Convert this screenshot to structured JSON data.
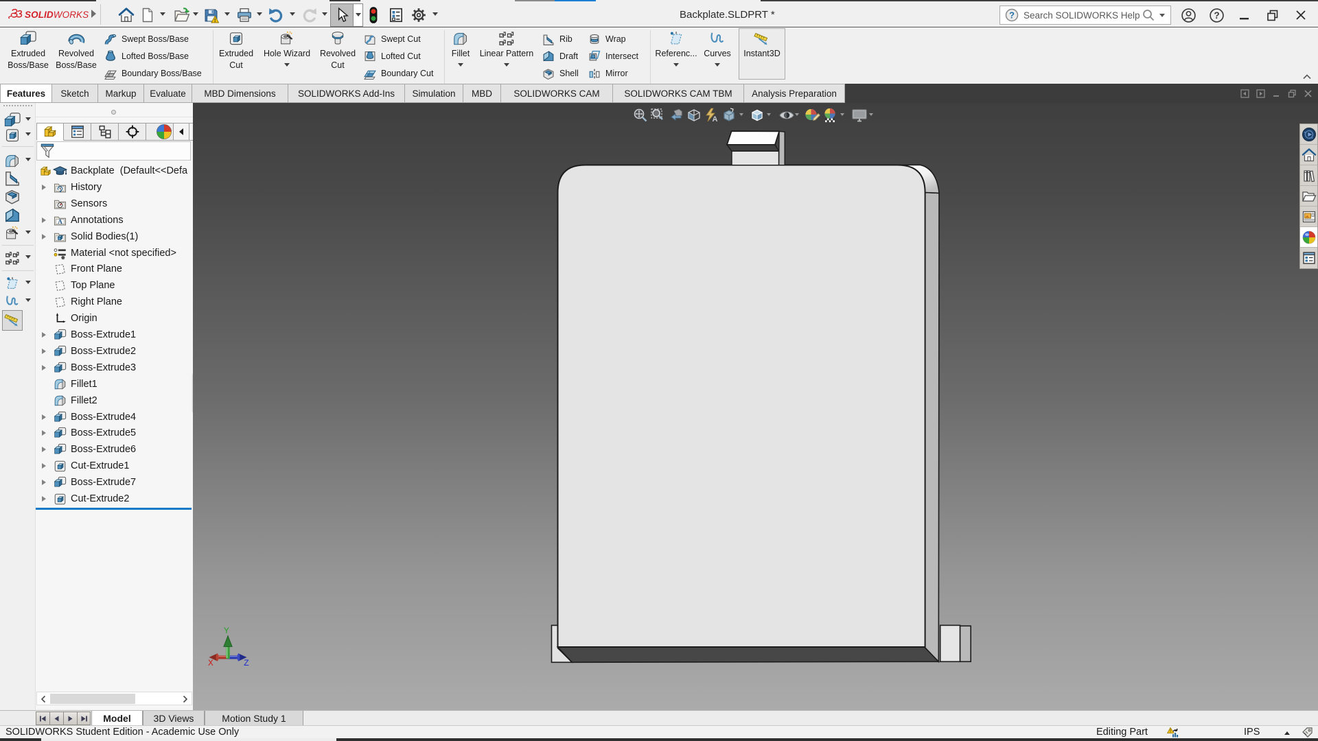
{
  "window": {
    "brand_prefix": "SOLID",
    "brand_suffix": "WORKS",
    "title": "Backplate.SLDPRT *",
    "control_icons": [
      "minimize-icon",
      "restore-icon",
      "close-icon"
    ]
  },
  "quick_access": {
    "icons": [
      "home-icon",
      "new-document-icon",
      "open-icon",
      "save-icon",
      "print-icon",
      "undo-icon",
      "redo-icon",
      "select-cursor-icon",
      "interference-traffic-light-icon",
      "document-properties-icon",
      "options-gear-icon"
    ]
  },
  "search": {
    "placeholder": "Search SOLIDWORKS Help",
    "icons": [
      "help-circle-icon",
      "magnifier-icon",
      "dropdown-caret-icon"
    ],
    "right_icons": [
      "account-icon",
      "help-icon"
    ]
  },
  "ribbon": {
    "extruded_boss_1": "Extruded",
    "extruded_boss_2": "Boss/Base",
    "revolved_boss_1": "Revolved",
    "revolved_boss_2": "Boss/Base",
    "swept_boss": "Swept Boss/Base",
    "lofted_boss": "Lofted Boss/Base",
    "boundary_boss": "Boundary Boss/Base",
    "extruded_cut_1": "Extruded",
    "extruded_cut_2": "Cut",
    "hole_wizard": "Hole Wizard",
    "revolved_cut_1": "Revolved",
    "revolved_cut_2": "Cut",
    "swept_cut": "Swept Cut",
    "lofted_cut": "Lofted Cut",
    "boundary_cut": "Boundary Cut",
    "fillet": "Fillet",
    "linear_pattern": "Linear Pattern",
    "rib": "Rib",
    "draft": "Draft",
    "shell": "Shell",
    "wrap": "Wrap",
    "intersect": "Intersect",
    "mirror": "Mirror",
    "reference": "Referenc...",
    "curves": "Curves",
    "instant3d": "Instant3D"
  },
  "command_tabs": {
    "items": [
      "Features",
      "Sketch",
      "Markup",
      "Evaluate",
      "MBD Dimensions",
      "SOLIDWORKS Add-Ins",
      "Simulation",
      "MBD",
      "SOLIDWORKS CAM",
      "SOLIDWORKS CAM TBM",
      "Analysis Preparation"
    ],
    "active": "Features",
    "mdi_icons": [
      "previous-window-icon",
      "next-window-icon",
      "minimize-window-icon",
      "restore-window-icon",
      "close-window-icon"
    ]
  },
  "feature_manager": {
    "tab_icons": [
      "featuremanager-tree-icon",
      "propertymanager-icon",
      "configurationmanager-icon",
      "dimxpertmanager-icon",
      "displaymanager-icon",
      "scroll-left-icon",
      "scroll-right-icon"
    ],
    "filter_icon": "filter-funnel-icon",
    "root": "Backplate  (Default<<Defa",
    "items": [
      {
        "label": "History",
        "icon": "history-folder-icon",
        "expandable": true
      },
      {
        "label": "Sensors",
        "icon": "sensors-folder-icon",
        "expandable": false
      },
      {
        "label": "Annotations",
        "icon": "annotations-folder-icon",
        "expandable": true
      },
      {
        "label": "Solid Bodies(1)",
        "icon": "solid-bodies-folder-icon",
        "expandable": true
      },
      {
        "label": "Material <not specified>",
        "icon": "material-icon",
        "expandable": false
      },
      {
        "label": "Front Plane",
        "icon": "plane-icon",
        "expandable": false
      },
      {
        "label": "Top Plane",
        "icon": "plane-icon",
        "expandable": false
      },
      {
        "label": "Right Plane",
        "icon": "plane-icon",
        "expandable": false
      },
      {
        "label": "Origin",
        "icon": "origin-icon",
        "expandable": false
      },
      {
        "label": "Boss-Extrude1",
        "icon": "boss-extrude-icon",
        "expandable": true
      },
      {
        "label": "Boss-Extrude2",
        "icon": "boss-extrude-icon",
        "expandable": true
      },
      {
        "label": "Boss-Extrude3",
        "icon": "boss-extrude-icon",
        "expandable": true
      },
      {
        "label": "Fillet1",
        "icon": "fillet-icon",
        "expandable": false
      },
      {
        "label": "Fillet2",
        "icon": "fillet-icon",
        "expandable": false
      },
      {
        "label": "Boss-Extrude4",
        "icon": "boss-extrude-icon",
        "expandable": true
      },
      {
        "label": "Boss-Extrude5",
        "icon": "boss-extrude-icon",
        "expandable": true
      },
      {
        "label": "Boss-Extrude6",
        "icon": "boss-extrude-icon",
        "expandable": true
      },
      {
        "label": "Cut-Extrude1",
        "icon": "cut-extrude-icon",
        "expandable": true
      },
      {
        "label": "Boss-Extrude7",
        "icon": "boss-extrude-icon",
        "expandable": true
      },
      {
        "label": "Cut-Extrude2",
        "icon": "cut-extrude-icon",
        "expandable": true
      }
    ]
  },
  "viewport": {
    "hud_icons": [
      "zoom-fit-icon",
      "zoom-area-icon",
      "previous-view-icon",
      "section-view-icon",
      "dynamic-annotation-icon",
      "view-orientation-icon",
      "display-style-icon",
      "hide-show-items-icon",
      "edit-appearance-icon",
      "apply-scene-icon",
      "view-settings-icon"
    ],
    "triad": {
      "x": "X",
      "y": "Y",
      "z": "Z"
    },
    "model_name": "backplate-part"
  },
  "task_pane": {
    "icons": [
      "threedexperience-icon",
      "solidworks-resources-icon",
      "design-library-icon",
      "file-explorer-icon",
      "view-palette-icon",
      "appearances-scenes-icon",
      "custom-properties-icon"
    ],
    "active": "appearances-scenes-icon"
  },
  "bottom_bar": {
    "nav_icons": [
      "first-icon",
      "previous-icon",
      "next-icon",
      "last-icon"
    ],
    "tabs": [
      "Model",
      "3D Views",
      "Motion Study 1"
    ],
    "active": "Model"
  },
  "status_bar": {
    "left": "SOLIDWORKS Student Edition - Academic Use Only",
    "mode": "Editing Part",
    "performance_icon": "performance-feedback-icon",
    "units": "IPS",
    "unit_caret_icon": "up-caret-icon",
    "tag_icon": "tag-icon"
  },
  "colors": {
    "brand_red": "#d2232a",
    "rollback_blue": "#1279c6",
    "edge_blue": "#1b7fd4",
    "viewport_top": "#414141",
    "viewport_bottom": "#adadad",
    "part_face": "#e4e4e4",
    "part_side": "#b9b9b9",
    "part_shadow": "#4a4a4a"
  }
}
